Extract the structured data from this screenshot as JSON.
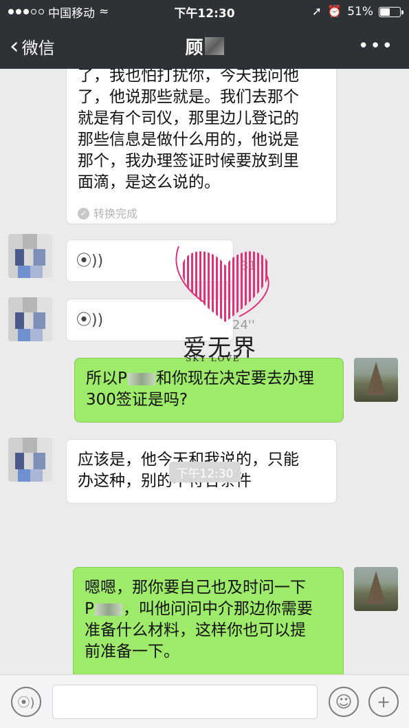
{
  "status_bar": {
    "carrier": "中国移动",
    "time": "下午12:30",
    "battery": "51%",
    "battery_level": 0.51
  },
  "nav": {
    "back_label": "微信",
    "title": "顾",
    "more": "•••"
  },
  "messages": [
    {
      "side": "left",
      "type": "voice-to-text",
      "text": "了，我也怕打扰你，今天我问他\n了，他说那些就是。我们去那个\n就是有个司仪，那里边儿登记的\n那些信息是做什么用的，他说是\n那个，我办理签证时候要放到里\n面滴，是这么说的。",
      "status": "转换完成"
    },
    {
      "side": "left",
      "type": "voice",
      "duration": "31''"
    },
    {
      "side": "left",
      "type": "voice",
      "duration": "24''"
    },
    {
      "side": "right",
      "type": "text",
      "text_before": "所以P",
      "text_after": "和你现在决定要去办理\n300签证是吗?"
    },
    {
      "side": "left",
      "type": "text",
      "text": "应该是，他今天和我说的，只能\n办这种，别的不符合条件"
    },
    {
      "side": "right",
      "type": "text",
      "line1": "嗯嗯，那你要自己也及时问一下",
      "line2_before": "P",
      "line2_after": "，叫他问问中介那边你需要",
      "rest": "准备什么材料，这样你也可以提\n前准备一下。"
    }
  ],
  "timestamp": "下午12:30",
  "watermark": {
    "text": "爱无界",
    "sub": "SKY LOVE"
  },
  "colors": {
    "header": "#2e3135",
    "background": "#ebebeb",
    "green_bubble": "#9eea6a",
    "watermark_pink": "#e0317a"
  },
  "icons": {
    "back": "chevron-left-icon",
    "more": "more-dots-icon",
    "voice": "voice-wave-icon",
    "emoji": "emoji-icon",
    "plus": "plus-icon"
  }
}
